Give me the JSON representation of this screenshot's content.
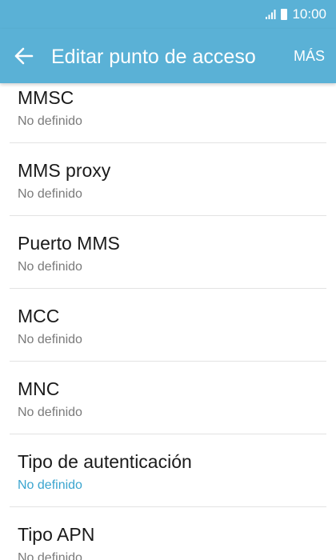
{
  "status_bar": {
    "time": "10:00",
    "signal_icon": "signal-icon",
    "battery_icon": "battery-icon"
  },
  "app_bar": {
    "back_icon": "back-arrow-icon",
    "title": "Editar punto de acceso",
    "more_label": "MÁS"
  },
  "colors": {
    "app_bar": "#5ab1d6",
    "accent_value": "#3aa5cf"
  },
  "settings": {
    "items": [
      {
        "title": "MMSC",
        "value": "No definido"
      },
      {
        "title": "MMS proxy",
        "value": "No definido"
      },
      {
        "title": "Puerto MMS",
        "value": "No definido"
      },
      {
        "title": "MCC",
        "value": "No definido"
      },
      {
        "title": "MNC",
        "value": "No definido"
      },
      {
        "title": "Tipo de autenticación",
        "value": "No definido"
      },
      {
        "title": "Tipo APN",
        "value": "No definido"
      }
    ]
  }
}
